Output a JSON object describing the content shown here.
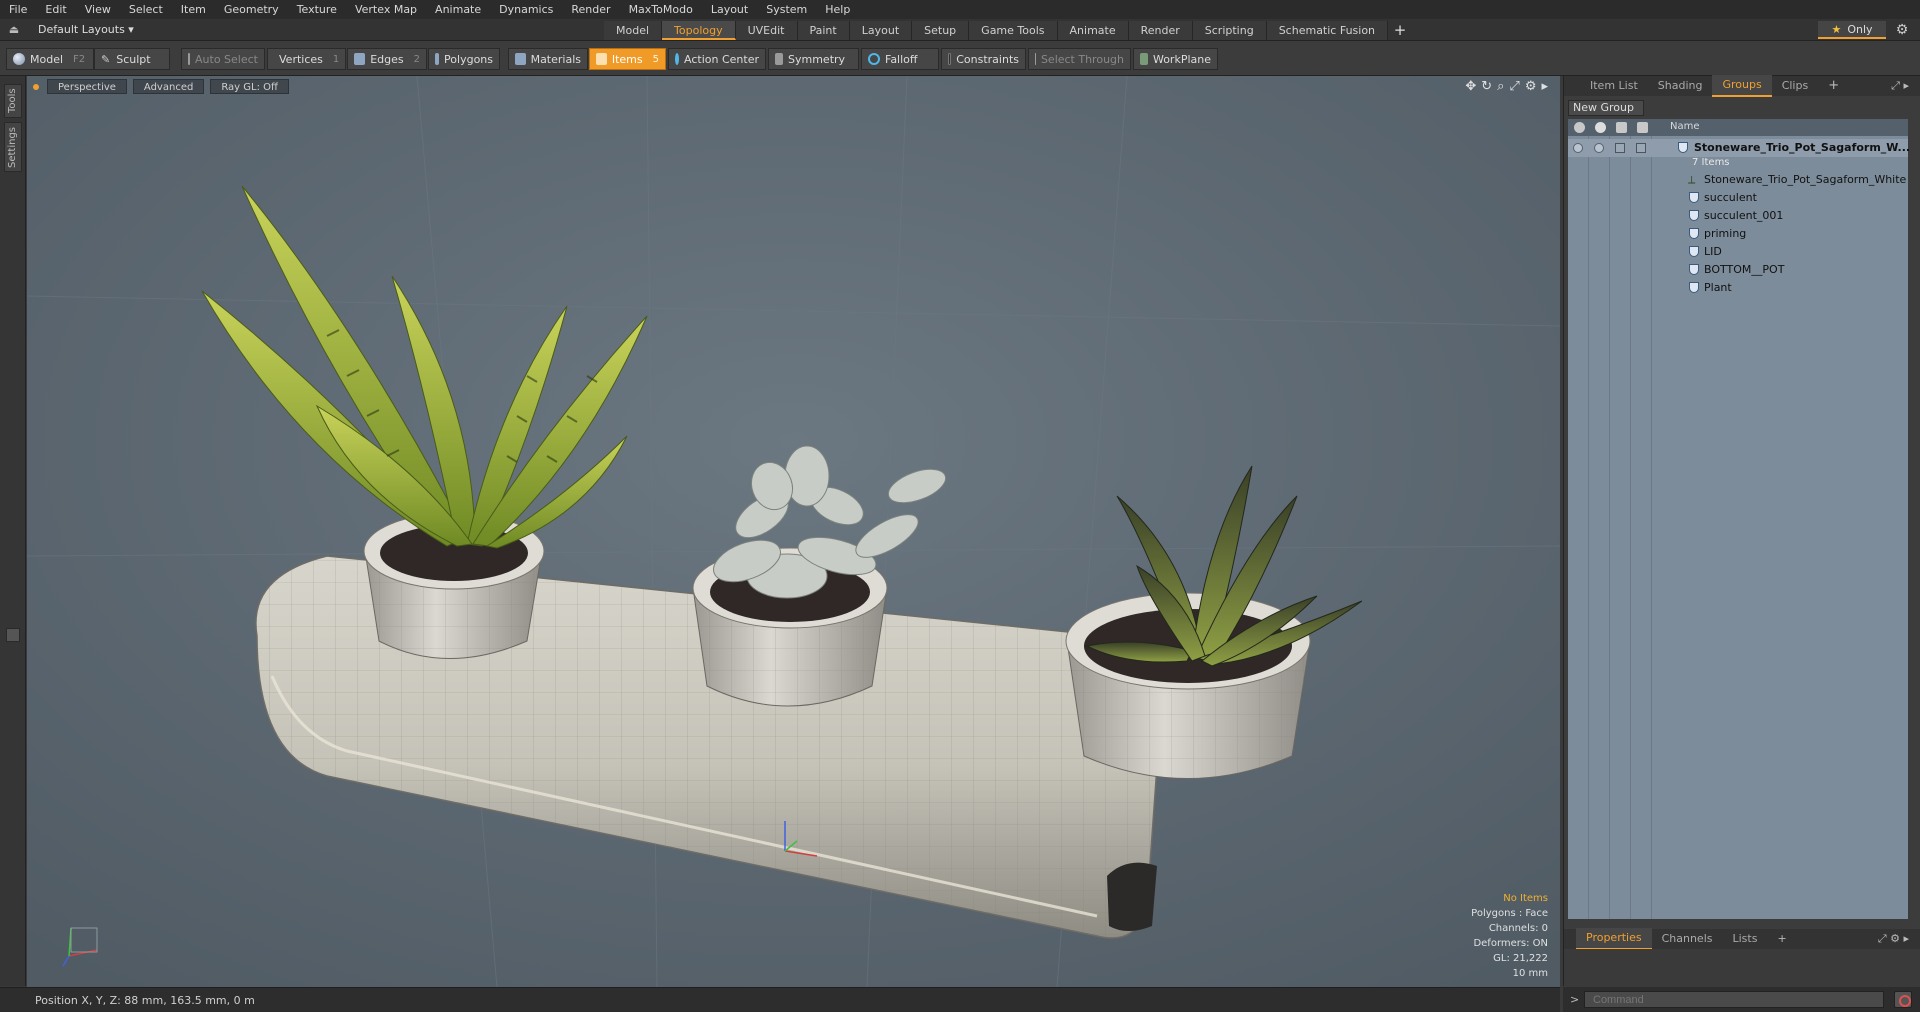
{
  "menu": [
    "File",
    "Edit",
    "View",
    "Select",
    "Item",
    "Geometry",
    "Texture",
    "Vertex Map",
    "Animate",
    "Dynamics",
    "Render",
    "MaxToModo",
    "Layout",
    "System",
    "Help"
  ],
  "layout_selector": "Default Layouts ▾",
  "tabs": [
    {
      "label": "Model",
      "active": false
    },
    {
      "label": "Topology",
      "active": true
    },
    {
      "label": "UVEdit",
      "active": false
    },
    {
      "label": "Paint",
      "active": false
    },
    {
      "label": "Layout",
      "active": false
    },
    {
      "label": "Setup",
      "active": false
    },
    {
      "label": "Game Tools",
      "active": false
    },
    {
      "label": "Animate",
      "active": false
    },
    {
      "label": "Render",
      "active": false
    },
    {
      "label": "Scripting",
      "active": false
    },
    {
      "label": "Schematic Fusion",
      "active": false
    }
  ],
  "tab_add": "+",
  "only_button": "Only",
  "toolbar": {
    "model": "Model",
    "model_key": "F2",
    "sculpt": "Sculpt",
    "auto_select": "Auto Select",
    "vertices": "Vertices",
    "vertices_key": "1",
    "edges": "Edges",
    "edges_key": "2",
    "polygons": "Polygons",
    "materials": "Materials",
    "items": "Items",
    "items_key": "5",
    "action_center": "Action Center",
    "symmetry": "Symmetry",
    "falloff": "Falloff",
    "constraints": "Constraints",
    "select_through": "Select Through",
    "workplane": "WorkPlane"
  },
  "left_tabs": {
    "tools": "Tools",
    "settings": "Settings"
  },
  "viewport": {
    "view": "Perspective",
    "advanced": "Advanced",
    "raygl": "Ray GL: Off",
    "info": {
      "no_items": "No Items",
      "polygons": "Polygons : Face",
      "channels": "Channels: 0",
      "deformers": "Deformers: ON",
      "gl": "GL: 21,222",
      "scale": "10 mm"
    },
    "accent_color": "#f0a030"
  },
  "right_panel": {
    "tabs": [
      {
        "label": "Item List",
        "active": false
      },
      {
        "label": "Shading",
        "active": false
      },
      {
        "label": "Groups",
        "active": true
      },
      {
        "label": "Clips",
        "active": false
      }
    ],
    "tab_add": "+",
    "new_group": "New Group",
    "column_name": "Name",
    "group_name": "Stoneware_Trio_Pot_Sagaform_W...",
    "group_count": "7 Items",
    "items": [
      {
        "label": "Stoneware_Trio_Pot_Sagaform_White",
        "icon": "locator-icon"
      },
      {
        "label": "succulent",
        "icon": "mesh-icon"
      },
      {
        "label": "succulent_001",
        "icon": "mesh-icon"
      },
      {
        "label": "priming",
        "icon": "mesh-icon"
      },
      {
        "label": "LID",
        "icon": "mesh-icon"
      },
      {
        "label": "BOTTOM__POT",
        "icon": "mesh-icon"
      },
      {
        "label": "Plant",
        "icon": "mesh-icon"
      }
    ],
    "bottom_tabs": [
      {
        "label": "Properties",
        "active": true
      },
      {
        "label": "Channels",
        "active": false
      },
      {
        "label": "Lists",
        "active": false
      }
    ],
    "bottom_tab_add": "+"
  },
  "status": {
    "position": "Position X, Y, Z:  88 mm, 163.5 mm, 0 m"
  },
  "command": {
    "placeholder": "Command",
    "arrow": ">"
  }
}
